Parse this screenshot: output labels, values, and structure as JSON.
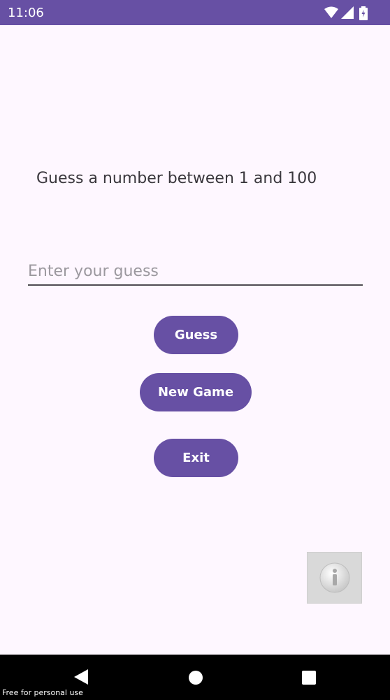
{
  "status_bar": {
    "time": "11:06",
    "icons": [
      "wifi-icon",
      "cellular-signal-icon",
      "battery-icon"
    ],
    "background": "#6750a4"
  },
  "game": {
    "prompt": "Guess a number between 1 and 100",
    "guess_input": {
      "value": "",
      "placeholder": "Enter your guess"
    },
    "buttons": {
      "guess": "Guess",
      "new_game": "New Game",
      "exit": "Exit"
    },
    "accent_color": "#6750a4"
  },
  "info_widget": {
    "icon": "info-icon"
  },
  "nav_bar": {
    "items": [
      "back-icon",
      "home-icon",
      "recent-apps-icon"
    ]
  },
  "watermark": "Free for personal use"
}
